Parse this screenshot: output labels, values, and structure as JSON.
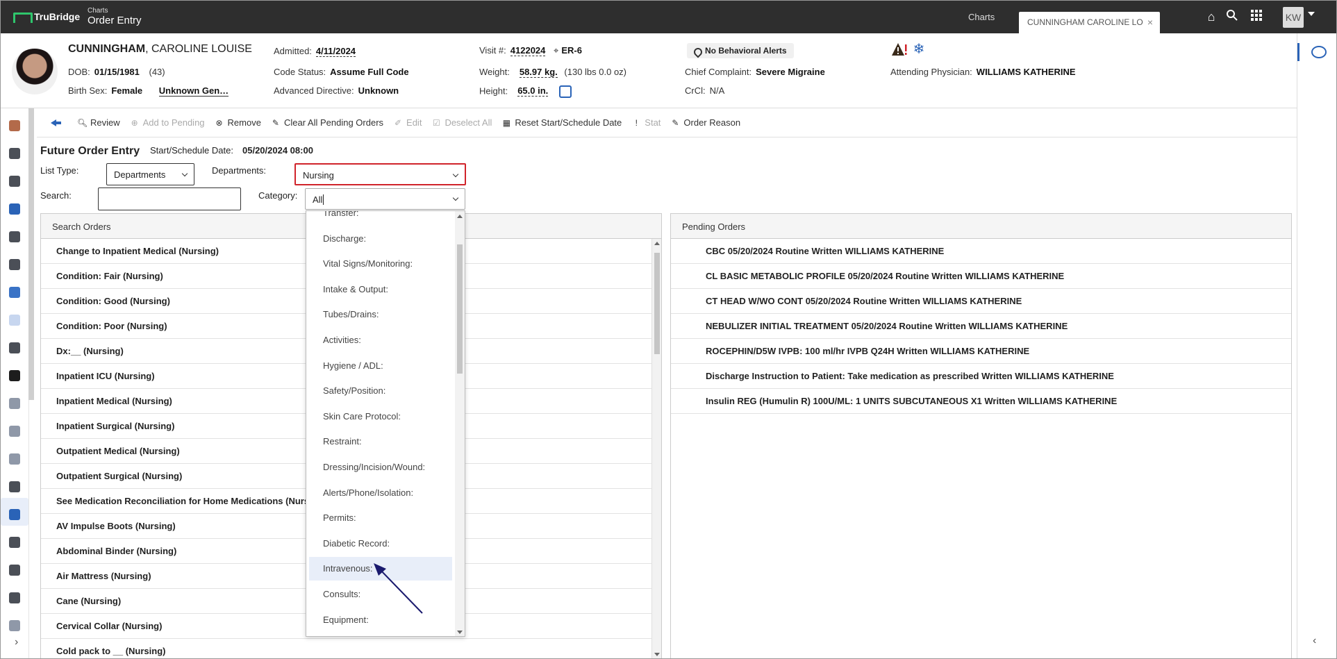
{
  "topbar": {
    "brand": "TruBridge",
    "crumb": "Charts",
    "title": "Order Entry",
    "tabs": [
      {
        "label": "Charts"
      },
      {
        "label": "CUNNINGHAM CAROLINE LO"
      }
    ],
    "user_initials": "KW"
  },
  "patient": {
    "last_name": "CUNNINGHAM",
    "first_names": ", CAROLINE LOUISE",
    "dob_label": "DOB:",
    "dob": "01/15/1981",
    "age": "(43)",
    "sex_label": "Birth Sex:",
    "sex": "Female",
    "gender": "Unknown Gen…",
    "admitted_label": "Admitted:",
    "admitted": "4/11/2024",
    "code_status_label": "Code Status:",
    "code_status": "Assume Full Code",
    "adv_dir_label": "Advanced Directive:",
    "adv_dir": "Unknown",
    "visit_label": "Visit #:",
    "visit": "4122024",
    "location": "ER-6",
    "weight_label": "Weight:",
    "weight": "58.97 kg.",
    "weight_alt": "(130 lbs 0.0 oz)",
    "height_label": "Height:",
    "height": "65.0 in.",
    "alerts": "No Behavioral Alerts",
    "complaint_label": "Chief Complaint:",
    "complaint": "Severe Migraine",
    "crcl_label": "CrCl:",
    "crcl": "N/A",
    "attending_label": "Attending Physician:",
    "attending": "WILLIAMS KATHERINE"
  },
  "toolbar": {
    "review": "Review",
    "add_pending": "Add to Pending",
    "remove": "Remove",
    "clear_all": "Clear All Pending Orders",
    "edit": "Edit",
    "deselect_all": "Deselect All",
    "reset_date": "Reset Start/Schedule Date",
    "stat": "Stat",
    "order_reason": "Order Reason"
  },
  "order_entry": {
    "title": "Future Order Entry",
    "start_label": "Start/Schedule Date:",
    "start_value": "05/20/2024 08:00",
    "list_type_label": "List Type:",
    "list_type_value": "Departments",
    "departments_label": "Departments:",
    "departments_value": "Nursing",
    "search_label": "Search:",
    "search_value": "",
    "category_label": "Category:",
    "category_value": "All"
  },
  "category_options": [
    "Transfer:",
    "Discharge:",
    "Vital Signs/Monitoring:",
    "Intake & Output:",
    "Tubes/Drains:",
    "Activities:",
    "Hygiene / ADL:",
    "Safety/Position:",
    "Skin Care Protocol:",
    "Restraint:",
    "Dressing/Incision/Wound:",
    "Alerts/Phone/Isolation:",
    "Permits:",
    "Diabetic Record:",
    "Intravenous:",
    "Consults:",
    "Equipment:"
  ],
  "search_orders": {
    "header": "Search Orders",
    "rows": [
      "Change to Inpatient Medical (Nursing)",
      "Condition: Fair (Nursing)",
      "Condition: Good (Nursing)",
      "Condition: Poor (Nursing)",
      "Dx:__ (Nursing)",
      "Inpatient ICU (Nursing)",
      "Inpatient Medical (Nursing)",
      "Inpatient Surgical (Nursing)",
      "Outpatient Medical (Nursing)",
      "Outpatient Surgical (Nursing)",
      "See Medication Reconciliation for Home Medications (Nursing)",
      "AV Impulse Boots (Nursing)",
      "Abdominal Binder (Nursing)",
      "Air Mattress (Nursing)",
      "Cane (Nursing)",
      "Cervical Collar (Nursing)",
      "Cold pack to __ (Nursing)"
    ]
  },
  "pending_orders": {
    "header": "Pending Orders",
    "rows": [
      "CBC 05/20/2024 Routine Written WILLIAMS KATHERINE",
      "CL BASIC METABOLIC PROFILE 05/20/2024 Routine Written WILLIAMS KATHERINE",
      "CT HEAD W/WO CONT 05/20/2024 Routine Written WILLIAMS KATHERINE",
      "NEBULIZER INITIAL TREATMENT 05/20/2024 Routine Written WILLIAMS KATHERINE",
      "ROCEPHIN/D5W IVPB: 100 ml/hr IVPB Q24H Written WILLIAMS KATHERINE",
      "Discharge Instruction to Patient: Take medication as prescribed Written WILLIAMS KATHERINE",
      "Insulin REG (Humulin R) 100U/ML: 1 UNITS SUBCUTANEOUS X1 Written WILLIAMS KATHERINE"
    ]
  },
  "colors": {
    "accent": "#2a63b7",
    "highlight": "#e8eef9",
    "error_border": "#d0232a",
    "topbar": "#2e2e2e"
  }
}
